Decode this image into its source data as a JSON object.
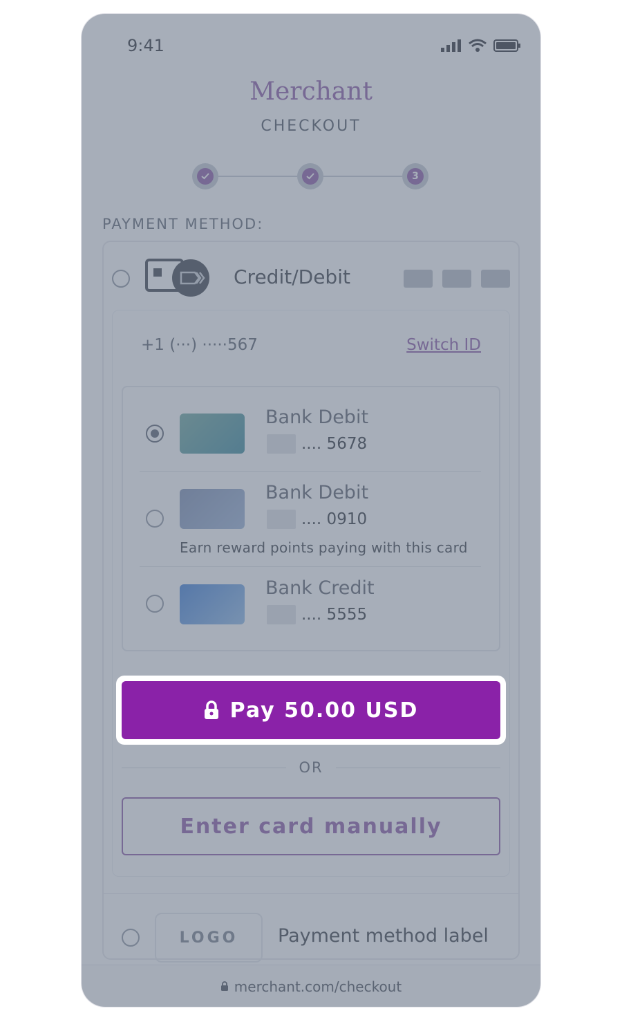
{
  "status": {
    "time": "9:41"
  },
  "header": {
    "merchant": "Merchant",
    "subtitle": "CHECKOUT"
  },
  "stepper": {
    "step3": "3"
  },
  "payment": {
    "section_label": "PAYMENT METHOD:",
    "option_title": "Credit/Debit",
    "phone": "+1 (···) ·····567",
    "switch_id": "Switch ID",
    "cards": [
      {
        "name": "Bank Debit",
        "last4": ".... 5678",
        "selected": true,
        "note": ""
      },
      {
        "name": "Bank Debit",
        "last4": ".... 0910",
        "selected": false,
        "note": "Earn reward points paying with this card"
      },
      {
        "name": "Bank Credit",
        "last4": ".... 5555",
        "selected": false,
        "note": ""
      }
    ],
    "pay_button": "Pay 50.00 USD",
    "or": "OR",
    "manual_button": "Enter card manually",
    "other_logo": "LOGO",
    "other_label": "Payment method label"
  },
  "footer": {
    "url": "merchant.com/checkout"
  },
  "colors": {
    "accent": "#8a22a8",
    "brand_text": "#8e5ba8",
    "overlay": "#687487"
  },
  "icons": [
    "signal-icon",
    "wifi-icon",
    "battery-icon",
    "check-icon",
    "card-wallet-icon",
    "lock-icon"
  ]
}
